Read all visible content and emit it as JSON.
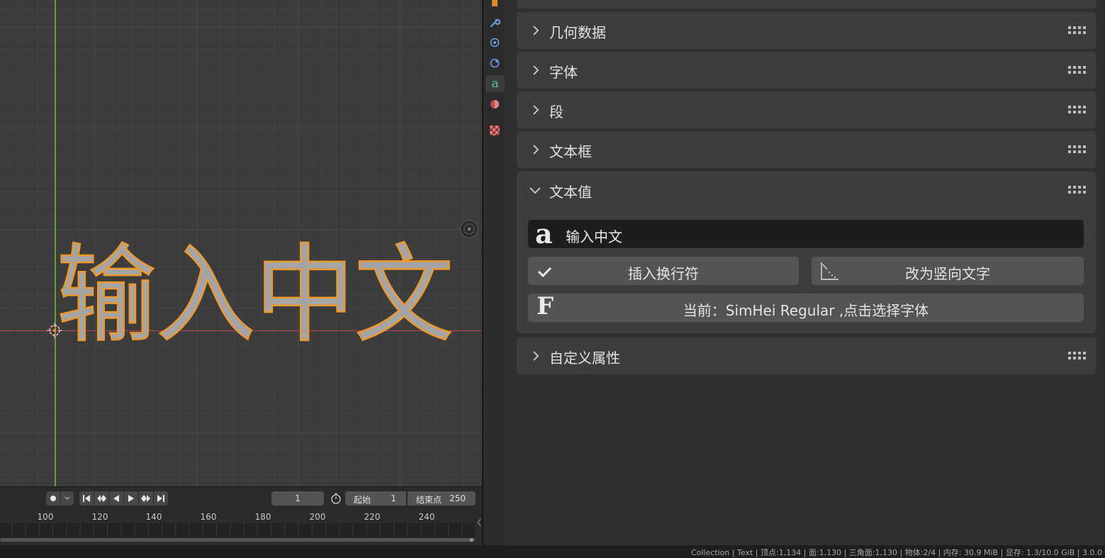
{
  "viewport": {
    "text_object": "输入中文"
  },
  "properties": {
    "panels": [
      {
        "label": "几何数据",
        "expanded": false
      },
      {
        "label": "字体",
        "expanded": false
      },
      {
        "label": "段",
        "expanded": false
      },
      {
        "label": "文本框",
        "expanded": false
      },
      {
        "label": "文本值",
        "expanded": true
      },
      {
        "label": "自定义属性",
        "expanded": false
      }
    ],
    "text_value": {
      "input_glyph": "a",
      "input_value": "输入中文",
      "insert_newline_label": "插入换行符",
      "vertical_text_label": "改为竖向文字",
      "font_glyph": "F",
      "font_button_label": "当前：SimHei Regular ,点击选择字体"
    }
  },
  "timeline": {
    "current_frame": "1",
    "start_label": "起始",
    "start_value": "1",
    "end_label": "结束点",
    "end_value": "250",
    "ruler_ticks": [
      "100",
      "120",
      "140",
      "160",
      "180",
      "200",
      "220",
      "240"
    ]
  },
  "status_bar": {
    "text": "Collection | Text | 顶点:1,134 | 面:1,130 | 三角面:1,130 | 物体:2/4 | 内存: 30.9 MiB | 显存: 1.3/10.0 GiB | 3.0.0"
  },
  "colors": {
    "selection_outline": "#f0982b",
    "text_fill": "#a5a5a5",
    "axis_x": "#b8434c",
    "axis_y": "#6e9a3a"
  },
  "icons": [
    "object-icon",
    "wrench-icon",
    "particles-icon",
    "physics-icon",
    "text-data-icon",
    "material-icon",
    "texture-icon"
  ]
}
